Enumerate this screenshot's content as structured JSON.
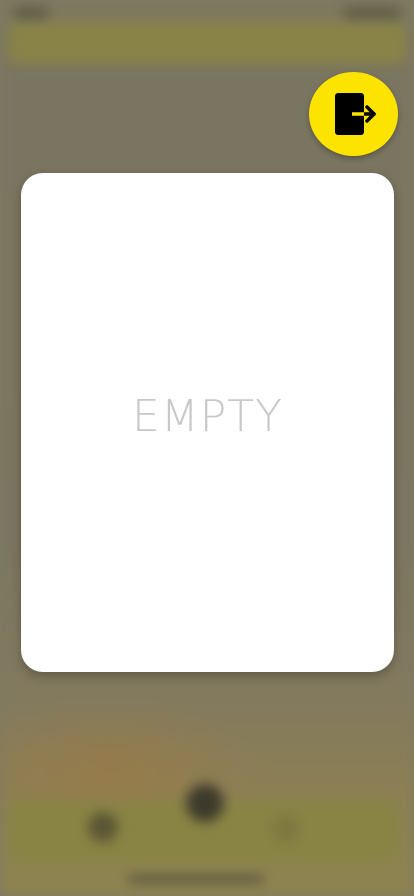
{
  "exit_button": {
    "icon": "logout-icon",
    "color": "#fde400"
  },
  "modal": {
    "empty_text": "EMPTY"
  },
  "background": {
    "overlay_color": "#7f7a63"
  }
}
